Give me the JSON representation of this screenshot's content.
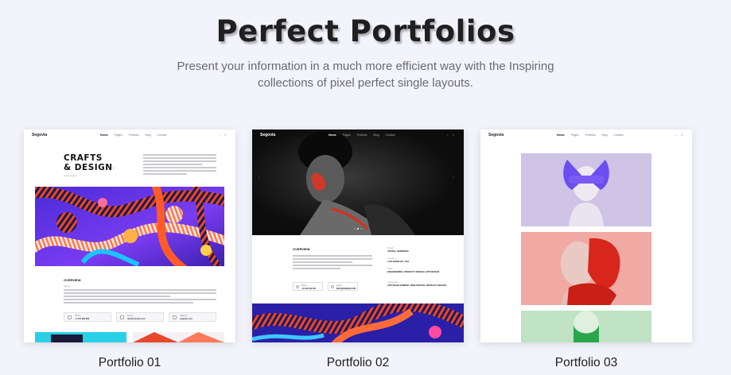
{
  "hero": {
    "title": "Perfect Portfolios",
    "subtitle_line1": "Present your information in a much more efficient way with the Inspiring",
    "subtitle_line2": "collections of pixel perfect single layouts."
  },
  "portfolios": [
    {
      "caption": "Portfolio 01"
    },
    {
      "caption": "Portfolio 02"
    },
    {
      "caption": "Portfolio 03"
    }
  ],
  "mini_site": {
    "logo": "Segovia",
    "nav": [
      "Home",
      "Pages",
      "Portfolio",
      "Blog",
      "Contact"
    ],
    "icons": "⌕ ≡"
  },
  "card1": {
    "title_line1": "CRAFTS",
    "title_line2": "& DESIGN",
    "title_mark": ".",
    "title_sub": "Lorem ipsum",
    "overview": "OVERVIEW",
    "overview_sub": "About",
    "contacts": [
      {
        "label": "Phone",
        "value": "+1 101 999 888"
      },
      {
        "label": "Email",
        "value": "info@domain.com"
      },
      {
        "label": "Address",
        "value": "segovia.com"
      }
    ]
  },
  "card2": {
    "overview": "OVERVIEW",
    "meta": [
      {
        "label": "Client",
        "value": "JOHN B. SENDRICK"
      },
      {
        "label": "Location",
        "value": "LOS ANGELES, USA"
      },
      {
        "label": "Skills",
        "value": "ENGINEERING, PRODUCT DESIGN, APP DESIGN"
      },
      {
        "label": "Categories",
        "value": "APP DEVELOPMENT, WEB DESIGN, PRODUCT DESIGN"
      }
    ],
    "buttons": [
      {
        "label": "Phone",
        "value": "+00 000 000 000"
      },
      {
        "label": "Email",
        "value": "INFO@DOMAIN.COM"
      }
    ]
  },
  "colors": {
    "background": "#f3f3fb",
    "title": "#1f1f1f",
    "subtitle": "#6a6a72",
    "accent_purple": "#6b4df0",
    "accent_red": "#e8472d"
  }
}
